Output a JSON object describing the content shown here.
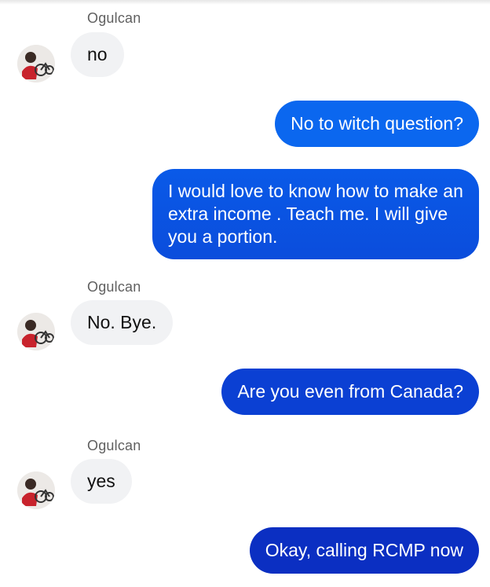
{
  "conversation": {
    "contact_name": "Ogulcan",
    "messages": [
      {
        "from": "contact",
        "text": "no"
      },
      {
        "from": "me",
        "text": "No to witch question?"
      },
      {
        "from": "me",
        "text": "I would love to know how to make an extra income . Teach me. I will give you a portion."
      },
      {
        "from": "contact",
        "text": "No. Bye."
      },
      {
        "from": "me",
        "text": "Are you even from Canada?"
      },
      {
        "from": "contact",
        "text": "yes"
      },
      {
        "from": "me",
        "text": "Okay, calling RCMP now"
      }
    ]
  },
  "colors": {
    "incoming_bubble": "#f1f2f4",
    "outgoing_gradient_top": "#0a6cf0",
    "outgoing_gradient_bottom": "#0b2fc2",
    "sender_name": "#606060"
  }
}
